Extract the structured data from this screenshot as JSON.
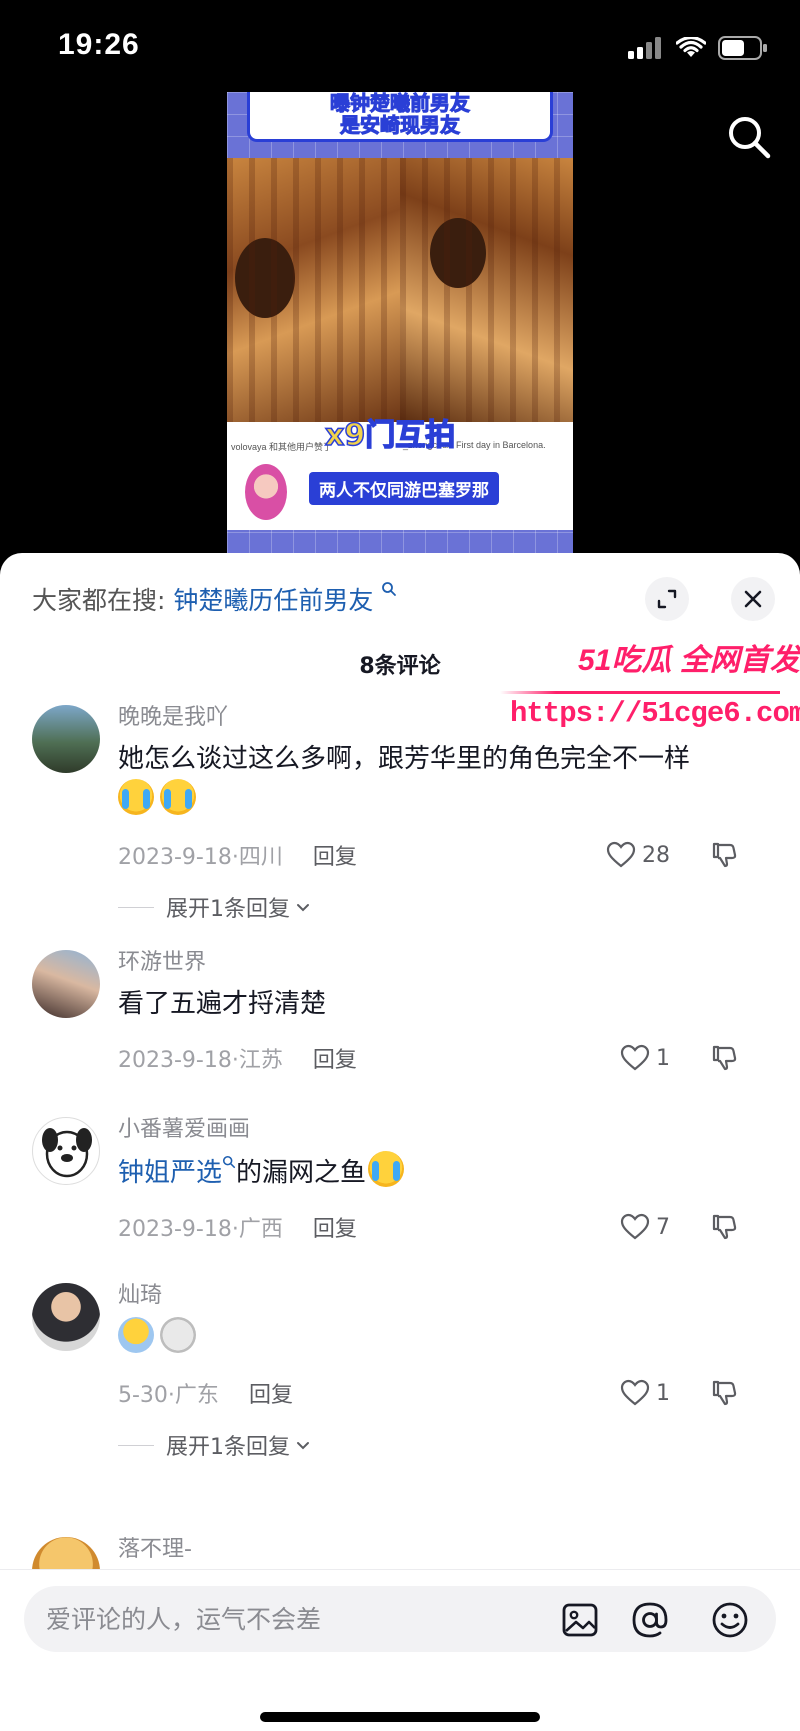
{
  "status_bar": {
    "time": "19:26"
  },
  "video": {
    "title_line1": "曝钟楚曦前男友",
    "title_line2": "是安崎现男友",
    "hint": "x9门互拍",
    "subtitle": "两人不仅同游巴塞罗那",
    "small_caption_left": "volovaya 和其他用户赞了",
    "small_caption_right": "_zhongchuxi First day in Barcelona."
  },
  "sheet": {
    "hot_search_prefix": "大家都在搜:",
    "hot_search_term": "钟楚曦历任前男友",
    "comment_count": "8条评论"
  },
  "watermark": {
    "brand": "51吃瓜 全网首发",
    "url": "https://51cge6.com"
  },
  "comments": [
    {
      "user": "晚晚是我吖",
      "text": "她怎么谈过这么多啊，跟芳华里的角色完全不一样",
      "date": "2023-9-18·四川",
      "reply": "回复",
      "likes": "28",
      "expand": "展开1条回复"
    },
    {
      "user": "环游世界",
      "text": "看了五遍才捋清楚",
      "date": "2023-9-18·江苏",
      "reply": "回复",
      "likes": "1"
    },
    {
      "user": "小番薯爱画画",
      "link": "钟姐严选",
      "text": "的漏网之鱼",
      "date": "2023-9-18·广西",
      "reply": "回复",
      "likes": "7"
    },
    {
      "user": "灿琦",
      "date": "5-30·广东",
      "reply": "回复",
      "likes": "1",
      "expand": "展开1条回复"
    },
    {
      "user": "落不理-"
    }
  ],
  "input": {
    "placeholder": "爱评论的人，运气不会差"
  }
}
